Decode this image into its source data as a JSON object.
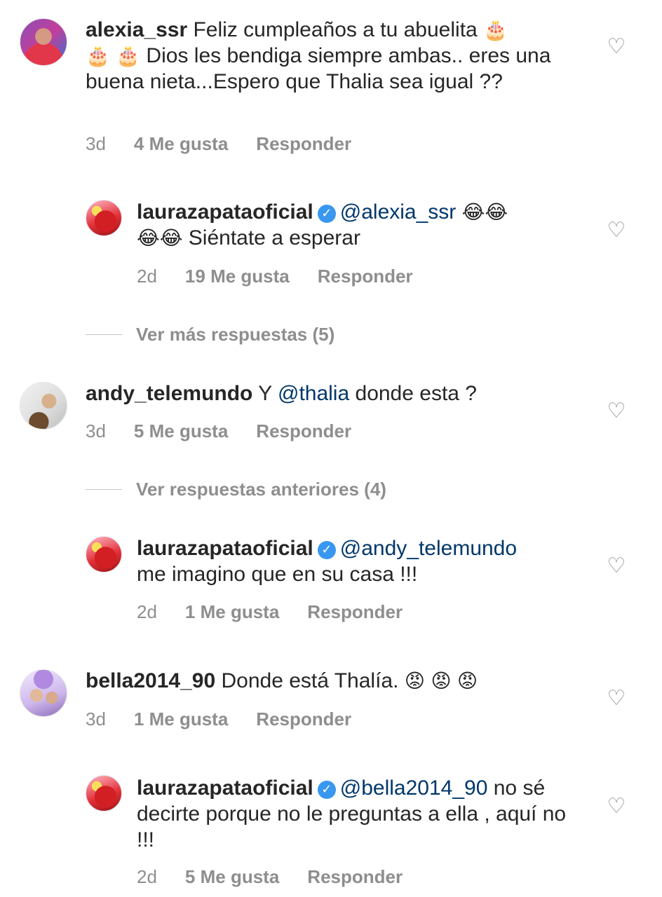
{
  "comments": [
    {
      "username": "alexia_ssr",
      "text_line1": " Feliz cumpleaños a tu abuelita ",
      "cake": "🎂",
      "text_line2": " Dios les bendiga siempre ambas.. eres una buena nieta...Espero que Thalia sea igual ??",
      "time": "3d",
      "likes": "4 Me gusta",
      "reply": "Responder"
    },
    {
      "username": "laurazapataoficial",
      "mention": "@alexia_ssr",
      "laugh": "😂",
      "text": " Siéntate a esperar",
      "time": "2d",
      "likes": "19 Me gusta",
      "reply": "Responder"
    },
    {
      "view_more": "Ver más respuestas (5)"
    },
    {
      "username": "andy_telemundo",
      "pre": " Y ",
      "mention": "@thalia",
      "text": "  donde esta ?",
      "time": "3d",
      "likes": "5 Me gusta",
      "reply": "Responder"
    },
    {
      "view_more": "Ver respuestas anteriores (4)"
    },
    {
      "username": "laurazapataoficial",
      "mention": "@andy_telemundo",
      "text": "me imagino que en su casa !!!",
      "time": "2d",
      "likes": "1 Me gusta",
      "reply": "Responder"
    },
    {
      "username": "bella2014_90",
      "text": " Donde está Thalía. ",
      "angry": "😡",
      "time": "3d",
      "likes": "1 Me gusta",
      "reply": "Responder"
    },
    {
      "username": "laurazapataoficial",
      "mention": "@bella2014_90",
      "text": " no sé decirte porque no le preguntas a ella , aquí no !!!",
      "time": "2d",
      "likes": "5 Me gusta",
      "reply": "Responder"
    }
  ],
  "icons": {
    "verified": "verified-badge-icon",
    "like": "heart-outline-icon"
  },
  "colors": {
    "mention": "#00376b",
    "meta": "#8e8e8e",
    "verified": "#3897f0"
  }
}
